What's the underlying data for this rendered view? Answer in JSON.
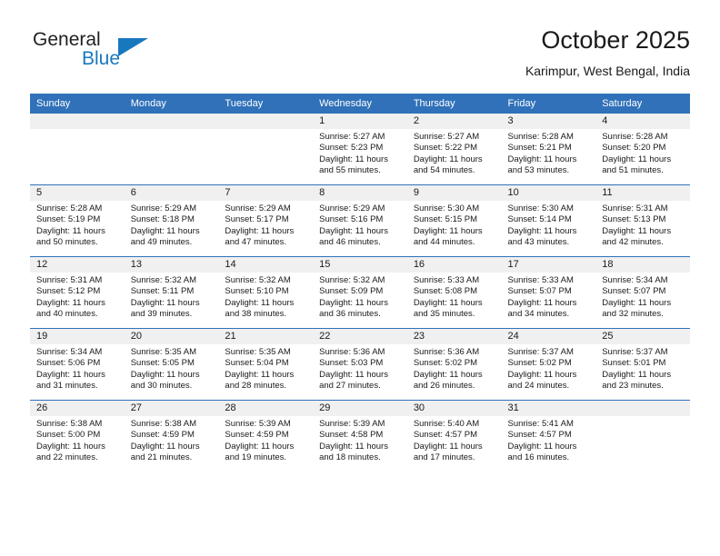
{
  "brand": {
    "name_part1": "General",
    "name_part2": "Blue",
    "logo_icon": "triangle-logo-icon",
    "accent_color": "#1878be"
  },
  "header": {
    "title": "October 2025",
    "location": "Karimpur, West Bengal, India"
  },
  "calendar": {
    "header_color": "#3071b9",
    "daynum_band_color": "#f0f0f0",
    "weekday_headers": [
      "Sunday",
      "Monday",
      "Tuesday",
      "Wednesday",
      "Thursday",
      "Friday",
      "Saturday"
    ],
    "weeks": [
      [
        {
          "day": "",
          "sunrise": "",
          "sunset": "",
          "daylight1": "",
          "daylight2": "",
          "empty": true
        },
        {
          "day": "",
          "sunrise": "",
          "sunset": "",
          "daylight1": "",
          "daylight2": "",
          "empty": true
        },
        {
          "day": "",
          "sunrise": "",
          "sunset": "",
          "daylight1": "",
          "daylight2": "",
          "empty": true
        },
        {
          "day": "1",
          "sunrise": "Sunrise: 5:27 AM",
          "sunset": "Sunset: 5:23 PM",
          "daylight1": "Daylight: 11 hours",
          "daylight2": "and 55 minutes.",
          "empty": false
        },
        {
          "day": "2",
          "sunrise": "Sunrise: 5:27 AM",
          "sunset": "Sunset: 5:22 PM",
          "daylight1": "Daylight: 11 hours",
          "daylight2": "and 54 minutes.",
          "empty": false
        },
        {
          "day": "3",
          "sunrise": "Sunrise: 5:28 AM",
          "sunset": "Sunset: 5:21 PM",
          "daylight1": "Daylight: 11 hours",
          "daylight2": "and 53 minutes.",
          "empty": false
        },
        {
          "day": "4",
          "sunrise": "Sunrise: 5:28 AM",
          "sunset": "Sunset: 5:20 PM",
          "daylight1": "Daylight: 11 hours",
          "daylight2": "and 51 minutes.",
          "empty": false
        }
      ],
      [
        {
          "day": "5",
          "sunrise": "Sunrise: 5:28 AM",
          "sunset": "Sunset: 5:19 PM",
          "daylight1": "Daylight: 11 hours",
          "daylight2": "and 50 minutes.",
          "empty": false
        },
        {
          "day": "6",
          "sunrise": "Sunrise: 5:29 AM",
          "sunset": "Sunset: 5:18 PM",
          "daylight1": "Daylight: 11 hours",
          "daylight2": "and 49 minutes.",
          "empty": false
        },
        {
          "day": "7",
          "sunrise": "Sunrise: 5:29 AM",
          "sunset": "Sunset: 5:17 PM",
          "daylight1": "Daylight: 11 hours",
          "daylight2": "and 47 minutes.",
          "empty": false
        },
        {
          "day": "8",
          "sunrise": "Sunrise: 5:29 AM",
          "sunset": "Sunset: 5:16 PM",
          "daylight1": "Daylight: 11 hours",
          "daylight2": "and 46 minutes.",
          "empty": false
        },
        {
          "day": "9",
          "sunrise": "Sunrise: 5:30 AM",
          "sunset": "Sunset: 5:15 PM",
          "daylight1": "Daylight: 11 hours",
          "daylight2": "and 44 minutes.",
          "empty": false
        },
        {
          "day": "10",
          "sunrise": "Sunrise: 5:30 AM",
          "sunset": "Sunset: 5:14 PM",
          "daylight1": "Daylight: 11 hours",
          "daylight2": "and 43 minutes.",
          "empty": false
        },
        {
          "day": "11",
          "sunrise": "Sunrise: 5:31 AM",
          "sunset": "Sunset: 5:13 PM",
          "daylight1": "Daylight: 11 hours",
          "daylight2": "and 42 minutes.",
          "empty": false
        }
      ],
      [
        {
          "day": "12",
          "sunrise": "Sunrise: 5:31 AM",
          "sunset": "Sunset: 5:12 PM",
          "daylight1": "Daylight: 11 hours",
          "daylight2": "and 40 minutes.",
          "empty": false
        },
        {
          "day": "13",
          "sunrise": "Sunrise: 5:32 AM",
          "sunset": "Sunset: 5:11 PM",
          "daylight1": "Daylight: 11 hours",
          "daylight2": "and 39 minutes.",
          "empty": false
        },
        {
          "day": "14",
          "sunrise": "Sunrise: 5:32 AM",
          "sunset": "Sunset: 5:10 PM",
          "daylight1": "Daylight: 11 hours",
          "daylight2": "and 38 minutes.",
          "empty": false
        },
        {
          "day": "15",
          "sunrise": "Sunrise: 5:32 AM",
          "sunset": "Sunset: 5:09 PM",
          "daylight1": "Daylight: 11 hours",
          "daylight2": "and 36 minutes.",
          "empty": false
        },
        {
          "day": "16",
          "sunrise": "Sunrise: 5:33 AM",
          "sunset": "Sunset: 5:08 PM",
          "daylight1": "Daylight: 11 hours",
          "daylight2": "and 35 minutes.",
          "empty": false
        },
        {
          "day": "17",
          "sunrise": "Sunrise: 5:33 AM",
          "sunset": "Sunset: 5:07 PM",
          "daylight1": "Daylight: 11 hours",
          "daylight2": "and 34 minutes.",
          "empty": false
        },
        {
          "day": "18",
          "sunrise": "Sunrise: 5:34 AM",
          "sunset": "Sunset: 5:07 PM",
          "daylight1": "Daylight: 11 hours",
          "daylight2": "and 32 minutes.",
          "empty": false
        }
      ],
      [
        {
          "day": "19",
          "sunrise": "Sunrise: 5:34 AM",
          "sunset": "Sunset: 5:06 PM",
          "daylight1": "Daylight: 11 hours",
          "daylight2": "and 31 minutes.",
          "empty": false
        },
        {
          "day": "20",
          "sunrise": "Sunrise: 5:35 AM",
          "sunset": "Sunset: 5:05 PM",
          "daylight1": "Daylight: 11 hours",
          "daylight2": "and 30 minutes.",
          "empty": false
        },
        {
          "day": "21",
          "sunrise": "Sunrise: 5:35 AM",
          "sunset": "Sunset: 5:04 PM",
          "daylight1": "Daylight: 11 hours",
          "daylight2": "and 28 minutes.",
          "empty": false
        },
        {
          "day": "22",
          "sunrise": "Sunrise: 5:36 AM",
          "sunset": "Sunset: 5:03 PM",
          "daylight1": "Daylight: 11 hours",
          "daylight2": "and 27 minutes.",
          "empty": false
        },
        {
          "day": "23",
          "sunrise": "Sunrise: 5:36 AM",
          "sunset": "Sunset: 5:02 PM",
          "daylight1": "Daylight: 11 hours",
          "daylight2": "and 26 minutes.",
          "empty": false
        },
        {
          "day": "24",
          "sunrise": "Sunrise: 5:37 AM",
          "sunset": "Sunset: 5:02 PM",
          "daylight1": "Daylight: 11 hours",
          "daylight2": "and 24 minutes.",
          "empty": false
        },
        {
          "day": "25",
          "sunrise": "Sunrise: 5:37 AM",
          "sunset": "Sunset: 5:01 PM",
          "daylight1": "Daylight: 11 hours",
          "daylight2": "and 23 minutes.",
          "empty": false
        }
      ],
      [
        {
          "day": "26",
          "sunrise": "Sunrise: 5:38 AM",
          "sunset": "Sunset: 5:00 PM",
          "daylight1": "Daylight: 11 hours",
          "daylight2": "and 22 minutes.",
          "empty": false
        },
        {
          "day": "27",
          "sunrise": "Sunrise: 5:38 AM",
          "sunset": "Sunset: 4:59 PM",
          "daylight1": "Daylight: 11 hours",
          "daylight2": "and 21 minutes.",
          "empty": false
        },
        {
          "day": "28",
          "sunrise": "Sunrise: 5:39 AM",
          "sunset": "Sunset: 4:59 PM",
          "daylight1": "Daylight: 11 hours",
          "daylight2": "and 19 minutes.",
          "empty": false
        },
        {
          "day": "29",
          "sunrise": "Sunrise: 5:39 AM",
          "sunset": "Sunset: 4:58 PM",
          "daylight1": "Daylight: 11 hours",
          "daylight2": "and 18 minutes.",
          "empty": false
        },
        {
          "day": "30",
          "sunrise": "Sunrise: 5:40 AM",
          "sunset": "Sunset: 4:57 PM",
          "daylight1": "Daylight: 11 hours",
          "daylight2": "and 17 minutes.",
          "empty": false
        },
        {
          "day": "31",
          "sunrise": "Sunrise: 5:41 AM",
          "sunset": "Sunset: 4:57 PM",
          "daylight1": "Daylight: 11 hours",
          "daylight2": "and 16 minutes.",
          "empty": false
        },
        {
          "day": "",
          "sunrise": "",
          "sunset": "",
          "daylight1": "",
          "daylight2": "",
          "empty": true
        }
      ]
    ]
  }
}
